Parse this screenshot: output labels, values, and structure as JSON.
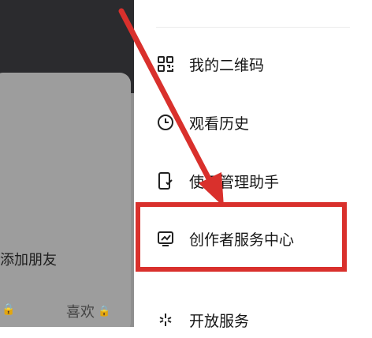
{
  "background": {
    "add_friend_label": "添加朋友",
    "like_label": "喜欢"
  },
  "menu": {
    "items": [
      {
        "label": "我的二维码",
        "icon": "qr-code-icon"
      },
      {
        "label": "观看历史",
        "icon": "clock-icon"
      },
      {
        "label": "使用管理助手",
        "icon": "phone-shield-icon"
      },
      {
        "label": "创作者服务中心",
        "icon": "chart-monitor-icon"
      },
      {
        "label": "开放服务",
        "icon": "sparkle-icon"
      }
    ],
    "highlighted_item": "创作者服务中心"
  },
  "annotation": {
    "color": "#d9302c"
  }
}
